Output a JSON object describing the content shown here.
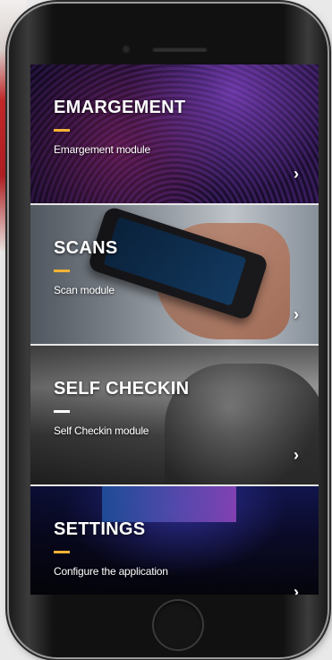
{
  "modules": [
    {
      "title": "EMARGEMENT",
      "subtitle": "Emargement module",
      "chevron": "›"
    },
    {
      "title": "SCANS",
      "subtitle": "Scan module",
      "chevron": "›"
    },
    {
      "title": "SELF CHECKIN",
      "subtitle": "Self Checkin module",
      "chevron": "›"
    },
    {
      "title": "SETTINGS",
      "subtitle": "Configure the application",
      "chevron": "›"
    }
  ],
  "colors": {
    "accent": "#f5b335",
    "text": "#ffffff"
  }
}
